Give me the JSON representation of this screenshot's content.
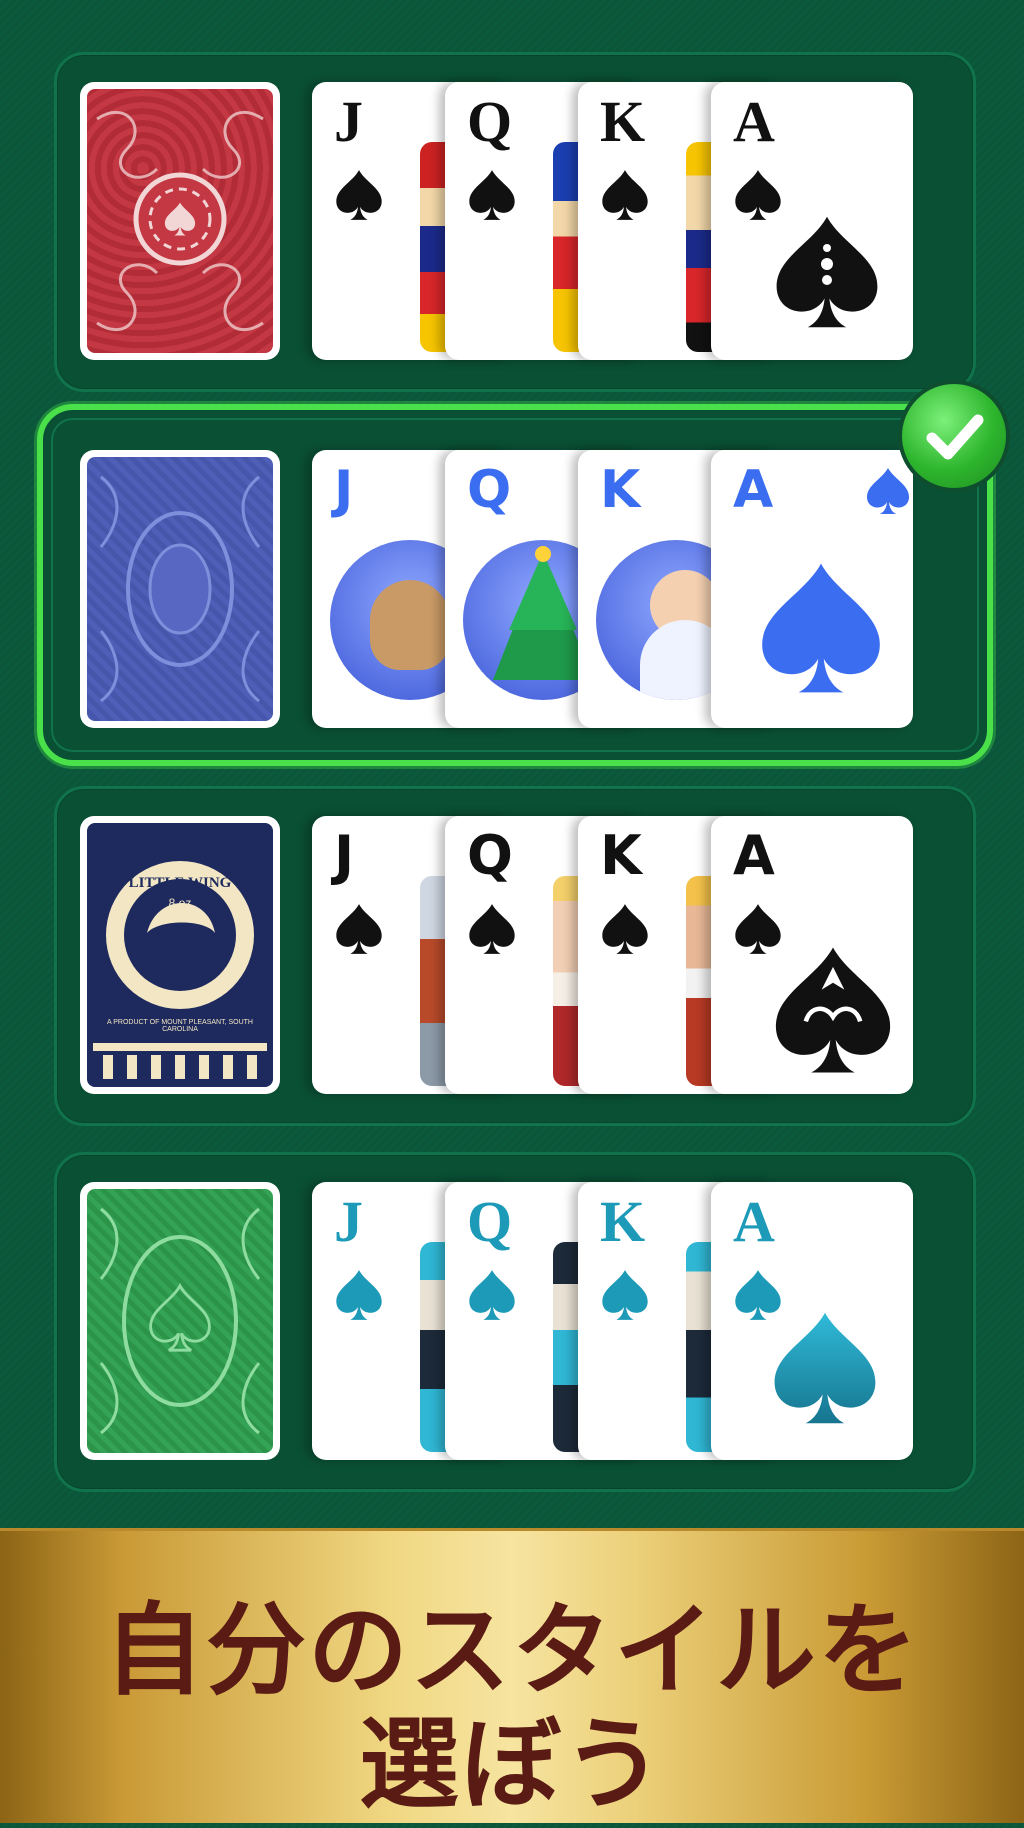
{
  "banner": {
    "line1": "自分のスタイルを",
    "line2": "選ぼう"
  },
  "selected_deck_index": 1,
  "decks": [
    {
      "name": "classic-red",
      "cards": [
        "J",
        "Q",
        "K",
        "A"
      ],
      "rank_color": "#111111",
      "back_color": "#b8303c"
    },
    {
      "name": "christmas-blue",
      "cards": [
        "J",
        "Q",
        "K",
        "A"
      ],
      "rank_color": "#3b6df0",
      "back_color": "#4b5ab0"
    },
    {
      "name": "little-wing",
      "cards": [
        "J",
        "Q",
        "K",
        "A"
      ],
      "rank_color": "#111111",
      "back_color": "#1e2a5e",
      "back_text": {
        "brand": "LITTLE WING",
        "size": "8 oz",
        "tagline": "A PRODUCT OF MOUNT PLEASANT, SOUTH CAROLINA"
      }
    },
    {
      "name": "teal-green",
      "cards": [
        "J",
        "Q",
        "K",
        "A"
      ],
      "rank_color": "#1c9ab8",
      "back_color": "#2f9a4e"
    }
  ]
}
